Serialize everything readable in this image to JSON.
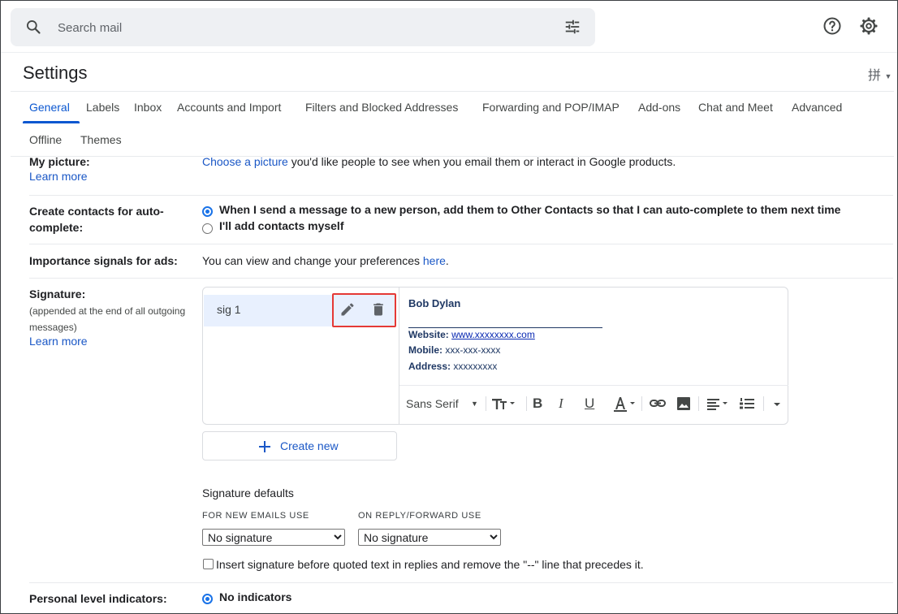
{
  "search": {
    "placeholder": "Search mail"
  },
  "page_title": "Settings",
  "ime_label": "拼",
  "tabs": [
    {
      "label": "General",
      "active": true
    },
    {
      "label": "Labels"
    },
    {
      "label": "Inbox"
    },
    {
      "label": "Accounts and Import"
    },
    {
      "label": "Filters and Blocked Addresses"
    },
    {
      "label": "Forwarding and POP/IMAP"
    },
    {
      "label": "Add-ons"
    },
    {
      "label": "Chat and Meet"
    },
    {
      "label": "Advanced"
    },
    {
      "label": "Offline"
    },
    {
      "label": "Themes"
    }
  ],
  "my_picture": {
    "label": "My picture:",
    "learn_more": "Learn more",
    "link": "Choose a picture",
    "text": " you'd like people to see when you email them or interact in Google products."
  },
  "contacts": {
    "label_line1": "Create contacts for auto-",
    "label_line2": "complete:",
    "option1": "When I send a message to a new person, add them to Other Contacts so that I can auto-complete to them next time",
    "option2": "I'll add contacts myself"
  },
  "importance": {
    "label": "Importance signals for ads:",
    "text": "You can view and change your preferences ",
    "link": "here",
    "period": "."
  },
  "signature": {
    "label": "Signature:",
    "sub_line1": "(appended at the end of all outgoing",
    "sub_line2": "messages)",
    "learn_more": "Learn more",
    "sig_name": "sig 1",
    "preview": {
      "name": "Bob Dylan",
      "website_label": "Website:",
      "website": "www.xxxxxxxx.com",
      "mobile_label": "Mobile:",
      "mobile": "xxx-xxx-xxxx",
      "address_label": "Address:",
      "address": "xxxxxxxxx"
    },
    "font": "Sans Serif",
    "create_new": "Create new"
  },
  "defaults": {
    "title": "Signature defaults",
    "new_emails_label": "FOR NEW EMAILS USE",
    "reply_label": "ON REPLY/FORWARD USE",
    "new_emails_value": "No signature",
    "reply_value": "No signature",
    "insert_before": "Insert signature before quoted text in replies and remove the \"--\" line that precedes it."
  },
  "personal_level": {
    "label": "Personal level indicators:",
    "option1": "No indicators"
  },
  "colors": {
    "accent": "#0b57d0",
    "link": "#1a57c6",
    "highlight_box": "#e53935",
    "selected_sig": "#e8f0fe"
  }
}
